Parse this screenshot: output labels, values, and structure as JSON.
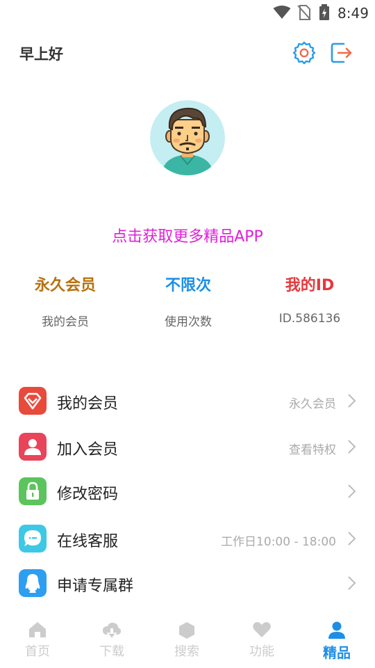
{
  "status_bar": {
    "time": "8:49"
  },
  "header": {
    "greeting": "早上好"
  },
  "promo": {
    "text": "点击获取更多精品APP"
  },
  "stats": [
    {
      "value": "永久会员",
      "caption": "我的会员"
    },
    {
      "value": "不限次",
      "caption": "使用次数"
    },
    {
      "value": "我的ID",
      "caption": "ID.586136"
    }
  ],
  "menu": [
    {
      "label": "我的会员",
      "sub": "永久会员",
      "icon": "diamond-icon",
      "color": "#e84a3c"
    },
    {
      "label": "加入会员",
      "sub": "查看特权",
      "icon": "person-icon",
      "color": "#e8445a"
    },
    {
      "label": "修改密码",
      "sub": "",
      "icon": "lock-icon",
      "color": "#5cc45c"
    },
    {
      "label": "在线客服",
      "sub": "工作日10:00 - 18:00",
      "icon": "chat-icon",
      "color": "#3ec8e6"
    },
    {
      "label": "申请专属群",
      "sub": "",
      "icon": "qq-icon",
      "color": "#2e9ef0"
    }
  ],
  "bottom_nav": [
    {
      "label": "首页",
      "icon": "home-icon",
      "active": false
    },
    {
      "label": "下载",
      "icon": "cloud-download-icon",
      "active": false
    },
    {
      "label": "搜索",
      "icon": "hexagon-icon",
      "active": false
    },
    {
      "label": "功能",
      "icon": "heart-icon",
      "active": false
    },
    {
      "label": "精品",
      "icon": "user-icon",
      "active": true
    }
  ],
  "colors": {
    "accent": "#1e8fe6",
    "promo": "#e020d8",
    "inactive_nav": "#cccccc"
  }
}
